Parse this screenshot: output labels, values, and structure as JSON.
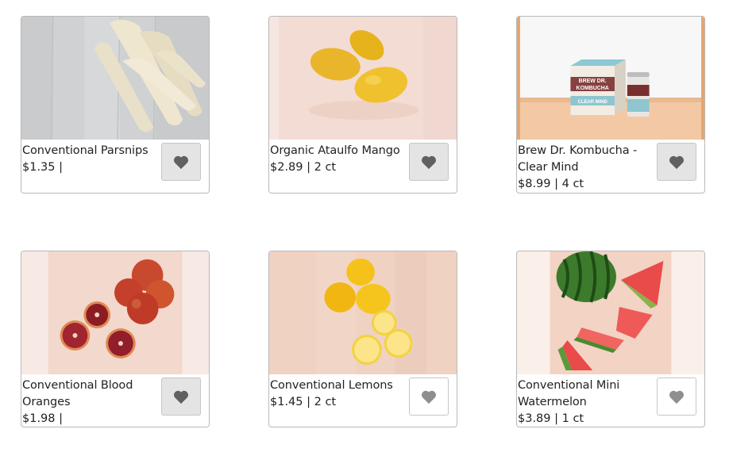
{
  "colors": {
    "favorite_filled_bg": "#e4e4e4",
    "favorite_outline_bg": "#ffffff",
    "heart_dark": "#606060",
    "heart_light": "#8e8e8e"
  },
  "products": [
    {
      "name": "Conventional Parsnips",
      "price": "$1.35 |",
      "image_icon": "parsnips-image",
      "favorite_style": "filled"
    },
    {
      "name": "Organic Ataulfo Mango",
      "price": "$2.89 | 2 ct",
      "image_icon": "mango-image",
      "favorite_style": "filled"
    },
    {
      "name": "Brew Dr. Kombucha - Clear Mind",
      "price": "$8.99 | 4 ct",
      "image_icon": "kombucha-image",
      "favorite_style": "filled"
    },
    {
      "name": "Conventional Blood Oranges",
      "price": "$1.98 |",
      "image_icon": "blood-oranges-image",
      "favorite_style": "filled"
    },
    {
      "name": "Conventional Lemons",
      "price": "$1.45 | 2 ct",
      "image_icon": "lemons-image",
      "favorite_style": "outline"
    },
    {
      "name": "Conventional Mini Watermelon",
      "price": "$3.89 | 1 ct",
      "image_icon": "watermelon-image",
      "favorite_style": "outline"
    }
  ],
  "kombucha_box": {
    "line1": "BREW DR.",
    "line2": "KOMBUCHA",
    "line3": "CLEAR MIND"
  }
}
